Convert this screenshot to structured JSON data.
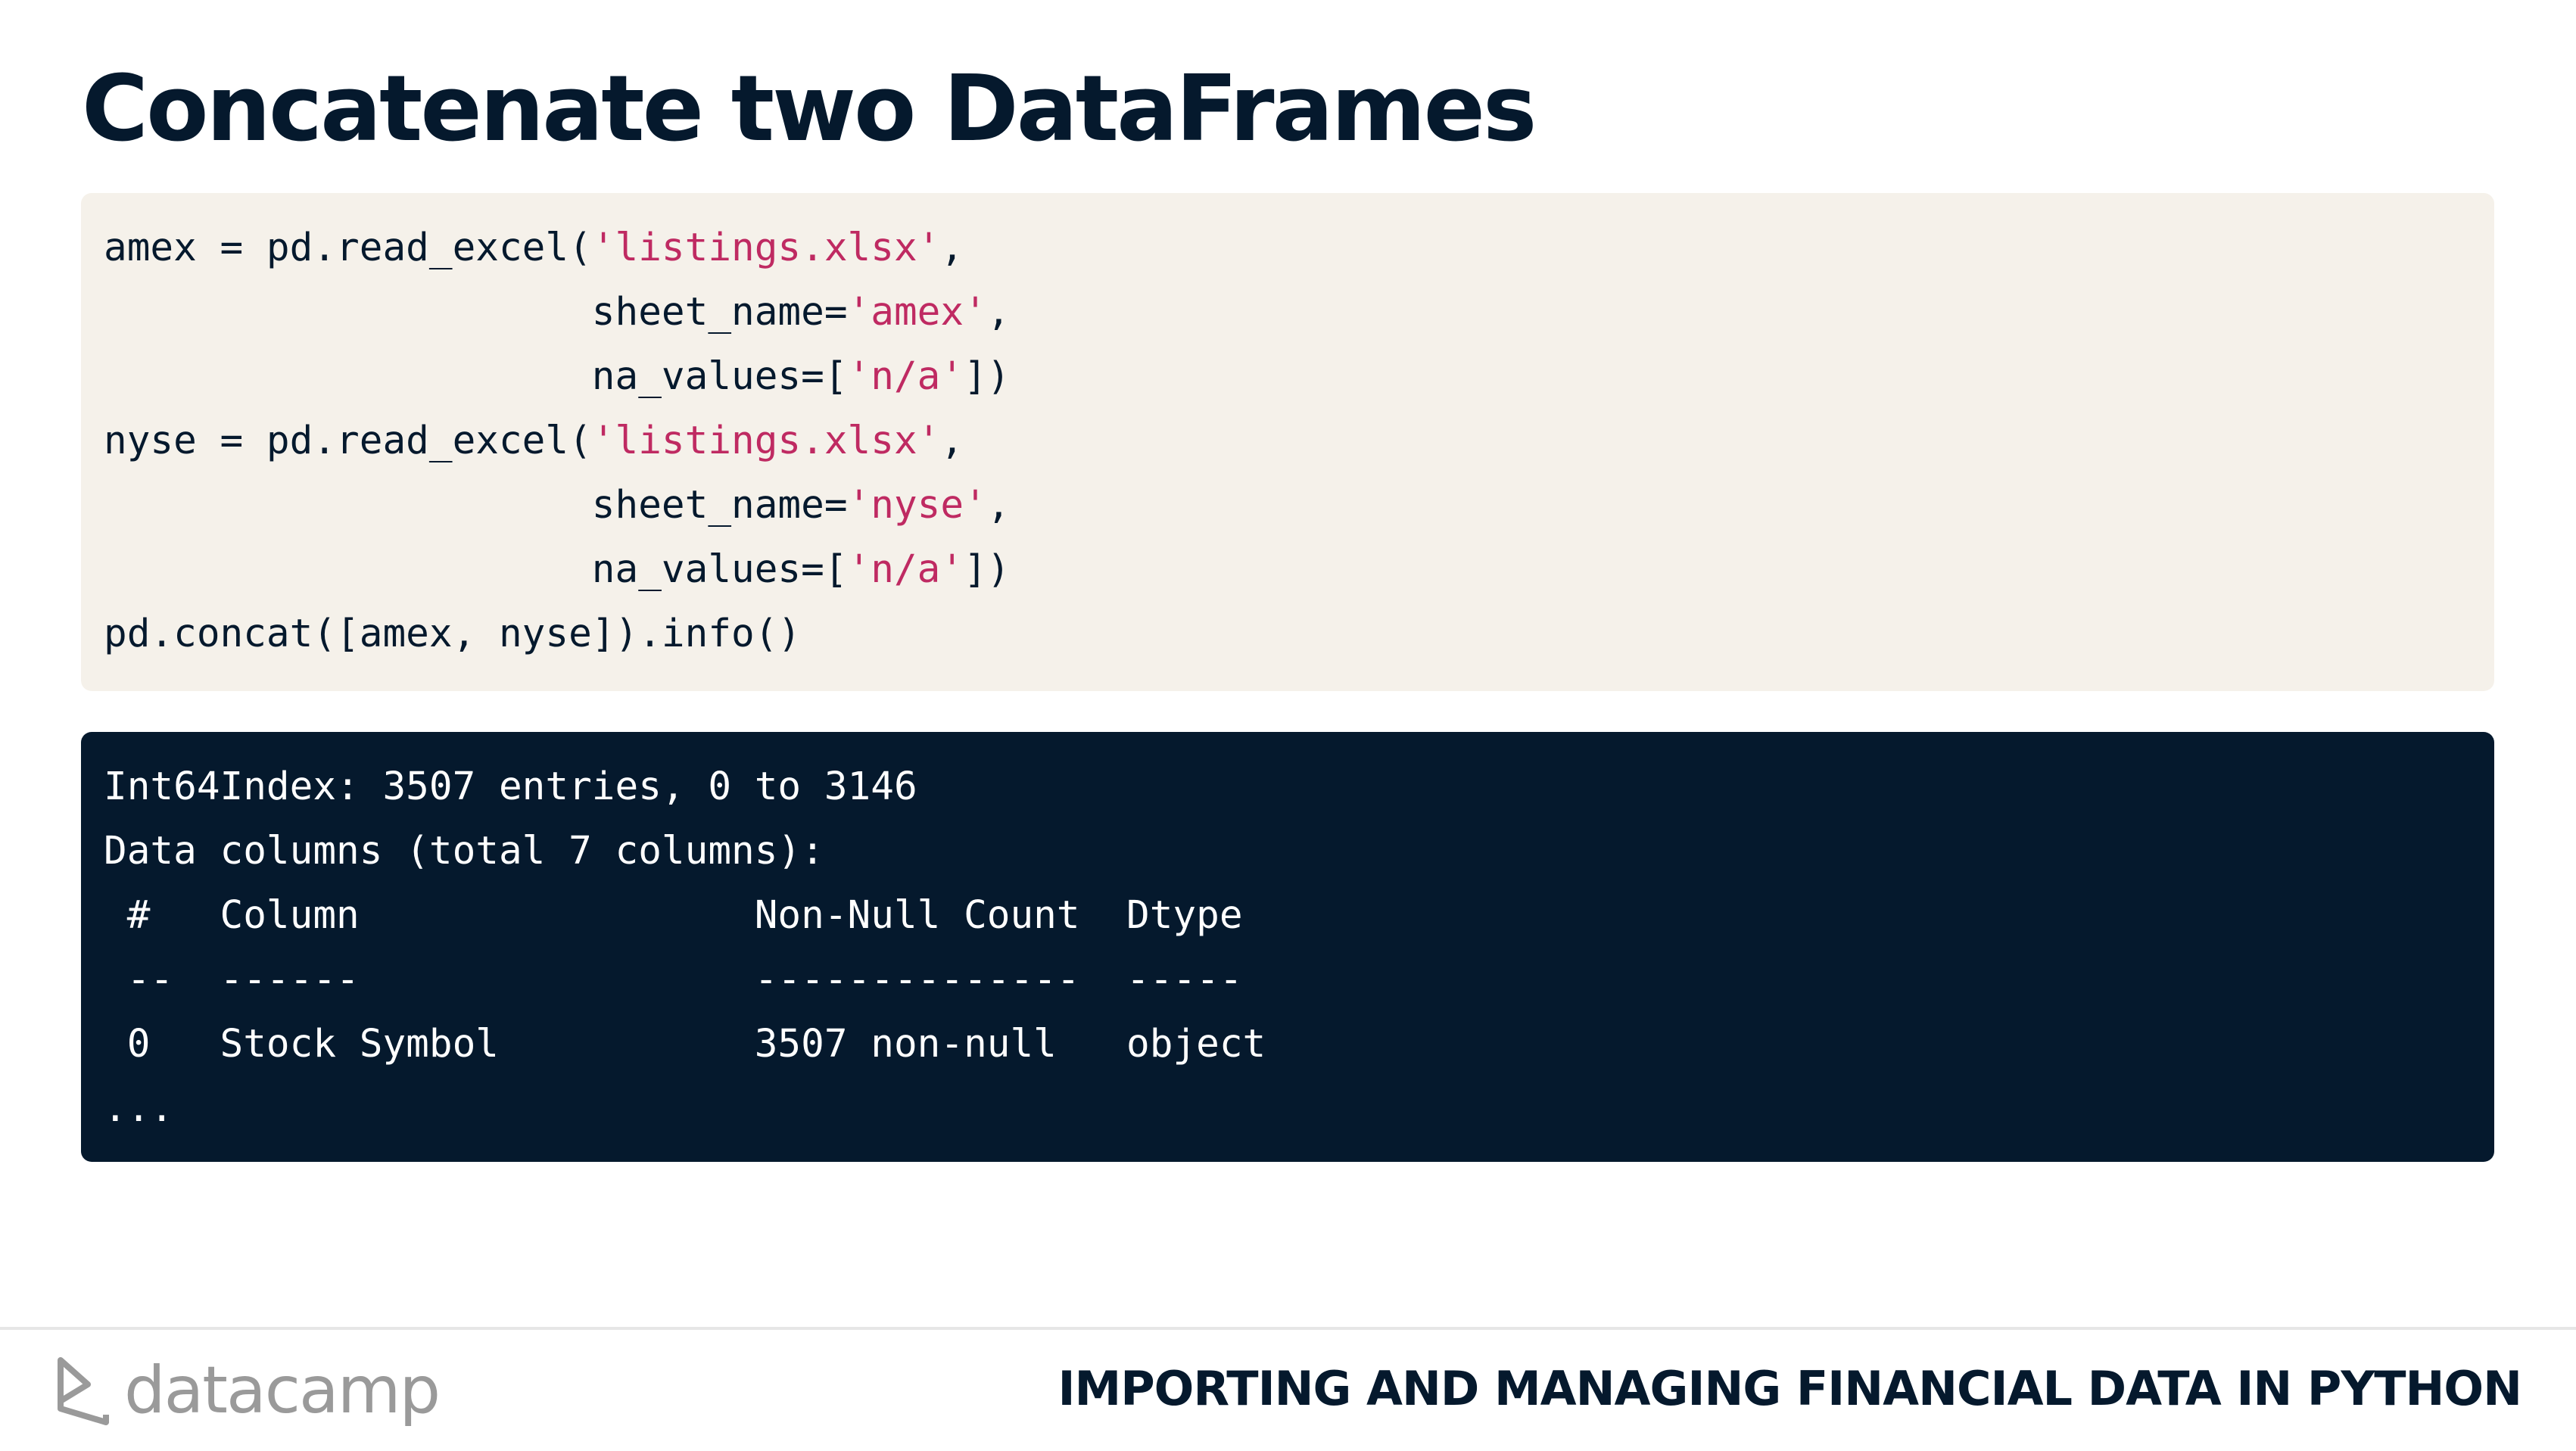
{
  "slide": {
    "title": "Concatenate two DataFrames"
  },
  "code": {
    "lines": [
      [
        {
          "t": "amex = pd.read_excel(",
          "k": "plain"
        },
        {
          "t": "'listings.xlsx'",
          "k": "str"
        },
        {
          "t": ",",
          "k": "plain"
        }
      ],
      [
        {
          "t": "                     sheet_name=",
          "k": "plain"
        },
        {
          "t": "'amex'",
          "k": "str"
        },
        {
          "t": ",",
          "k": "plain"
        }
      ],
      [
        {
          "t": "                     na_values=[",
          "k": "plain"
        },
        {
          "t": "'n/a'",
          "k": "str"
        },
        {
          "t": "])",
          "k": "plain"
        }
      ],
      [
        {
          "t": "nyse = pd.read_excel(",
          "k": "plain"
        },
        {
          "t": "'listings.xlsx'",
          "k": "str"
        },
        {
          "t": ",",
          "k": "plain"
        }
      ],
      [
        {
          "t": "                     sheet_name=",
          "k": "plain"
        },
        {
          "t": "'nyse'",
          "k": "str"
        },
        {
          "t": ",",
          "k": "plain"
        }
      ],
      [
        {
          "t": "                     na_values=[",
          "k": "plain"
        },
        {
          "t": "'n/a'",
          "k": "str"
        },
        {
          "t": "])",
          "k": "plain"
        }
      ],
      [
        {
          "t": "pd.concat([amex, nyse]).info()",
          "k": "plain"
        }
      ]
    ]
  },
  "output": {
    "lines": [
      "Int64Index: 3507 entries, 0 to 3146",
      "Data columns (total 7 columns):",
      " #   Column                 Non-Null Count  Dtype ",
      " --  ------                 --------------  ----- ",
      " 0   Stock Symbol           3507 non-null   object",
      "..."
    ]
  },
  "footer": {
    "logo_text": "datacamp",
    "logo_icon": "datacamp-logo-icon",
    "course_title": "IMPORTING AND MANAGING FINANCIAL DATA IN PYTHON"
  },
  "colors": {
    "title": "#05192d",
    "code_background": "#f5f1ea",
    "output_background": "#05192d",
    "string_literal": "#bf2a62",
    "logo": "#9a9a9a"
  }
}
